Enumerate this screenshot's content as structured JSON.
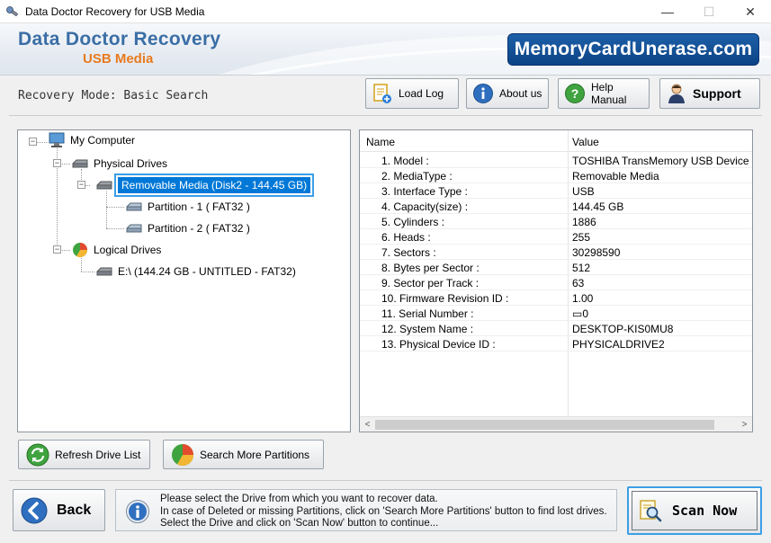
{
  "window": {
    "title": "Data Doctor Recovery for USB Media",
    "minimize": "—",
    "maximize": "☐",
    "close": "✕"
  },
  "banner": {
    "title": "Data Doctor Recovery",
    "subtitle": "USB Media",
    "site": "MemoryCardUnerase.com"
  },
  "mode_text": "Recovery Mode: Basic Search",
  "toolbar": {
    "load_log": "Load Log",
    "about_us": "About us",
    "help_manual": "Help Manual",
    "support": "Support"
  },
  "tree": {
    "my_computer": "My Computer",
    "physical_drives": "Physical Drives",
    "removable_media": "Removable Media (Disk2 - 144.45 GB)",
    "partition1": "Partition - 1 ( FAT32 )",
    "partition2": "Partition - 2 ( FAT32 )",
    "logical_drives": "Logical Drives",
    "logical_e": "E:\\ (144.24 GB - UNTITLED - FAT32)"
  },
  "details": {
    "header_name": "Name",
    "header_value": "Value",
    "rows": [
      {
        "name": "1. Model :",
        "value": "TOSHIBA TransMemory USB Device"
      },
      {
        "name": "2. MediaType :",
        "value": "Removable Media"
      },
      {
        "name": "3. Interface Type :",
        "value": "USB"
      },
      {
        "name": "4. Capacity(size) :",
        "value": "144.45 GB"
      },
      {
        "name": "5. Cylinders :",
        "value": "1886"
      },
      {
        "name": "6. Heads :",
        "value": "255"
      },
      {
        "name": "7. Sectors :",
        "value": "30298590"
      },
      {
        "name": "8. Bytes per Sector :",
        "value": "512"
      },
      {
        "name": "9. Sector per Track :",
        "value": "63"
      },
      {
        "name": "10. Firmware Revision ID :",
        "value": "1.00"
      },
      {
        "name": "11. Serial Number :",
        "value": "▭0"
      },
      {
        "name": "12. System Name :",
        "value": "DESKTOP-KIS0MU8"
      },
      {
        "name": "13. Physical Device ID :",
        "value": "PHYSICALDRIVE2"
      }
    ],
    "scroll_left": "<",
    "scroll_right": ">"
  },
  "buttons": {
    "refresh": "Refresh Drive List",
    "search_more": "Search More Partitions",
    "back": "Back",
    "scan_now": "Scan Now"
  },
  "info": {
    "line1": "Please select the Drive from which you want to recover data.",
    "line2": "In case of Deleted or missing Partitions, click on 'Search More Partitions' button to find lost drives.",
    "line3": "Select the Drive and click on 'Scan Now' button to continue..."
  },
  "colors": {
    "accent": "#0078d7",
    "brand_blue": "#3a6ea5",
    "brand_orange": "#e87a1e",
    "badge": "#1d5fa8"
  }
}
